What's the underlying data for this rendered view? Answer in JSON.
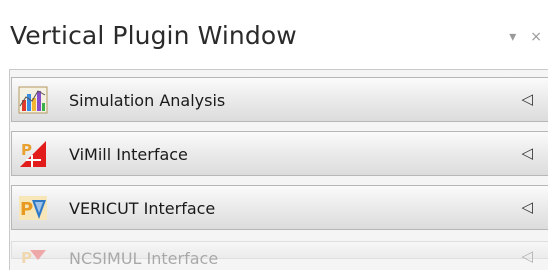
{
  "window": {
    "title": "Vertical Plugin Window",
    "dropdown_glyph": "▾",
    "close_glyph": "×"
  },
  "plugins": [
    {
      "label": "Simulation Analysis",
      "icon": "simulation-analysis-icon",
      "arrow": "◁"
    },
    {
      "label": "ViMill Interface",
      "icon": "vimill-icon",
      "arrow": "◁"
    },
    {
      "label": "VERICUT Interface",
      "icon": "vericut-icon",
      "arrow": "◁"
    },
    {
      "label": "NCSIMUL Interface",
      "icon": "ncsimul-icon",
      "arrow": "◁"
    }
  ],
  "colors": {
    "accent_red": "#e21b1b",
    "accent_orange": "#f0a030",
    "accent_blue": "#2e78c8"
  }
}
